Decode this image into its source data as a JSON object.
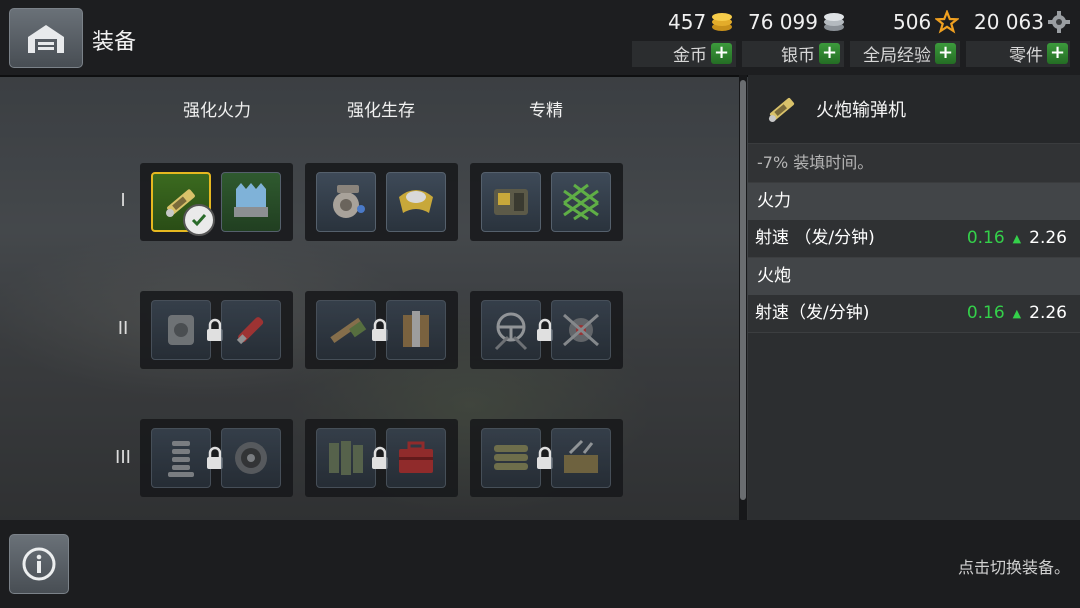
{
  "header": {
    "title": "装备",
    "resources": [
      {
        "value": "457",
        "icon": "gold-coin-icon",
        "label": "金币"
      },
      {
        "value": "76 099",
        "icon": "silver-coin-icon",
        "label": "银币"
      },
      {
        "value": "506",
        "icon": "star-icon",
        "label": "全局经验"
      },
      {
        "value": "20 063",
        "icon": "gear-part-icon",
        "label": "零件"
      }
    ],
    "plus_label": "+"
  },
  "columns": [
    "强化火力",
    "强化生存",
    "专精"
  ],
  "tiers": [
    "I",
    "II",
    "III"
  ],
  "slots": {
    "row1": [
      "shell-rammer-icon",
      "ammo-rack-icon",
      "engine-part-icon",
      "protective-gear-icon",
      "repair-kit-icon",
      "camo-net-icon"
    ],
    "row2": [
      "gun-mount-icon",
      "shell-icon",
      "cleaning-rod-icon",
      "armor-plate-icon",
      "steering-wheel-icon",
      "engine-tuning-icon"
    ],
    "row3": [
      "spring-coil-icon",
      "turbo-icon",
      "reinforcement-icon",
      "toolbox-icon",
      "sandbag-icon",
      "field-repair-icon"
    ]
  },
  "detail": {
    "title": "火炮输弹机",
    "description": "-7% 装填时间。",
    "sections": [
      {
        "name": "火力",
        "stat": "射速 （发/分钟)",
        "delta": "0.16",
        "arrow": "▲",
        "value": "2.26"
      },
      {
        "name": "火炮",
        "stat": "射速（发/分钟)",
        "delta": "0.16",
        "arrow": "▲",
        "value": "2.26"
      }
    ]
  },
  "footer": {
    "hint": "点击切换装备。"
  },
  "colors": {
    "accent_gold": "#e6b820",
    "stat_green": "#34d04a",
    "plus_green": "#3c9a3c"
  }
}
